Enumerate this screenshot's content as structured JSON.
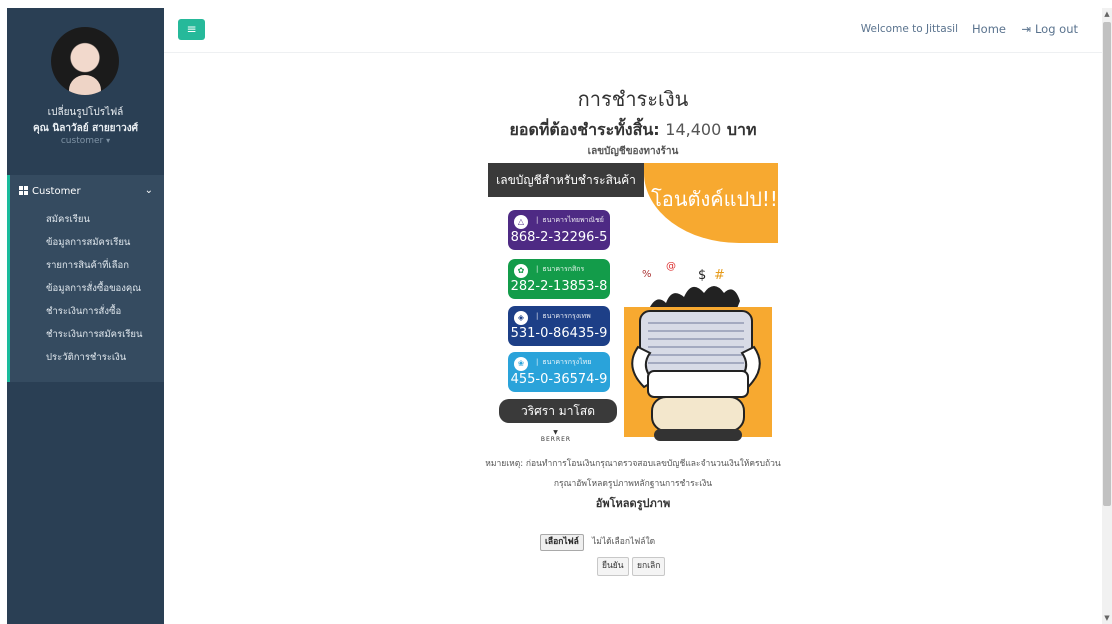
{
  "sidebar": {
    "change_photo": "เปลี่ยนรูปโปรไฟล์",
    "user_name": "คุณ นิลาวัลย์ สายยาวงศ์",
    "user_role": "customer",
    "menu_title": "Customer",
    "items": [
      {
        "label": "สมัครเรียน"
      },
      {
        "label": "ข้อมูลการสมัครเรียน"
      },
      {
        "label": "รายการสินค้าที่เลือก"
      },
      {
        "label": "ข้อมูลการสั่งซื้อของคุณ"
      },
      {
        "label": "ชำระเงินการสั่งซื้อ"
      },
      {
        "label": "ชำระเงินการสมัครเรียน"
      },
      {
        "label": "ประวัติการชำระเงิน"
      }
    ]
  },
  "topnav": {
    "welcome": "Welcome to Jittasil",
    "home": "Home",
    "logout": "Log out"
  },
  "main": {
    "title": "การชำระเงิน",
    "total_label": "ยอดที่ต้องชำระทั้งสิ้น:",
    "total_amount": "14,400",
    "total_unit": "บาท",
    "account_heading": "เลขบัญชีของทางร้าน",
    "note": "หมายเหตุ: ก่อนทำการโอนเงินกรุณาตรวจสอบเลขบัญชีและจำนวนเงินให้ครบถ้วน",
    "upload_instruction": "กรุณาอัพโหลดรูปภาพหลักฐานการชำระเงิน",
    "upload_heading": "อัพโหลดรูปภาพ",
    "choose_file": "เลือกไฟล์",
    "no_file": "ไม่ได้เลือกไฟล์ใด",
    "confirm": "ยืนยัน",
    "cancel": "ยกเลิก"
  },
  "bank_image": {
    "header": "เลขบัญชีสำหรับชำระสินค้า",
    "promo": "โอนตังค์แปป!!",
    "banks": [
      {
        "name": "ธนาคารไทยพาณิชย์",
        "account": "868-2-32296-5",
        "color": "#4e2a84"
      },
      {
        "name": "ธนาคารกสิกร",
        "account": "282-2-13853-8",
        "color": "#139c4a"
      },
      {
        "name": "ธนาคารกรุงเทพ",
        "account": "531-0-86435-9",
        "color": "#1d3f87"
      },
      {
        "name": "ธนาคารกรุงไทย",
        "account": "455-0-36574-9",
        "color": "#2aa3da"
      }
    ],
    "account_name": "วริศรา มาโสด",
    "brand": "BERRER"
  },
  "colors": {
    "sidebar_bg": "#2a3f54",
    "accent": "#26b99a",
    "promo_orange": "#f7a930"
  }
}
